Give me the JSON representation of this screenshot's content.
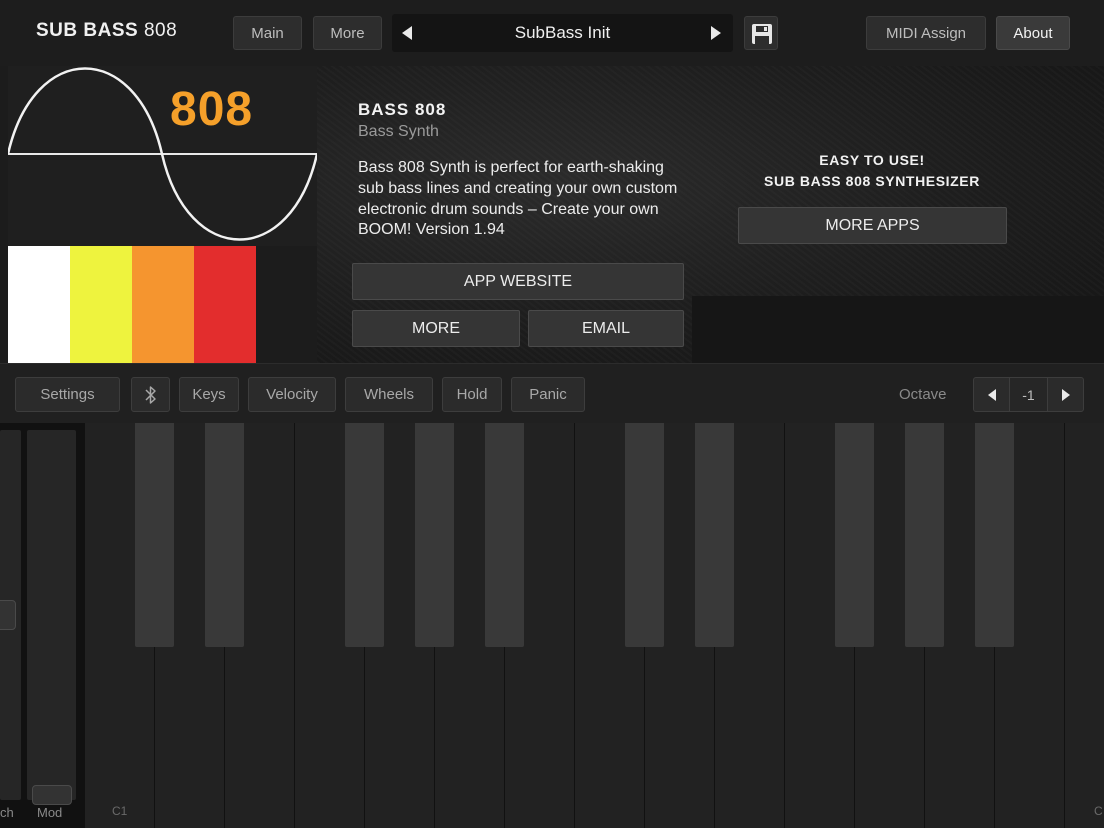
{
  "app": {
    "title_bold": "SUB BASS",
    "title_light": "808"
  },
  "topbar": {
    "main_label": "Main",
    "more_label": "More",
    "preset_name": "SubBass Init",
    "midi_assign_label": "MIDI Assign",
    "about_label": "About"
  },
  "logo": {
    "text": "808",
    "color": "#f5a02a",
    "stripe_colors": [
      "#ffffff",
      "#eef33e",
      "#f5952f",
      "#e32d2d"
    ]
  },
  "about": {
    "title": "BASS 808",
    "subtitle": "Bass Synth",
    "description": "Bass 808 Synth is perfect for earth-shaking sub bass lines and creating your own custom electronic drum sounds – Create your own BOOM!    Version 1.94",
    "website_button": "APP WEBSITE",
    "more_button": "MORE",
    "email_button": "EMAIL",
    "promo_line1": "EASY TO USE!",
    "promo_line2": "SUB BASS 808 SYNTHESIZER",
    "more_apps_button": "MORE APPS"
  },
  "toolbar": {
    "settings_label": "Settings",
    "keys_label": "Keys",
    "velocity_label": "Velocity",
    "wheels_label": "Wheels",
    "hold_label": "Hold",
    "panic_label": "Panic",
    "octave_label": "Octave",
    "octave_value": "-1"
  },
  "keyboard": {
    "pitch_label": "ch",
    "mod_label": "Mod",
    "first_key_label": "C1",
    "last_key_label": "C"
  }
}
